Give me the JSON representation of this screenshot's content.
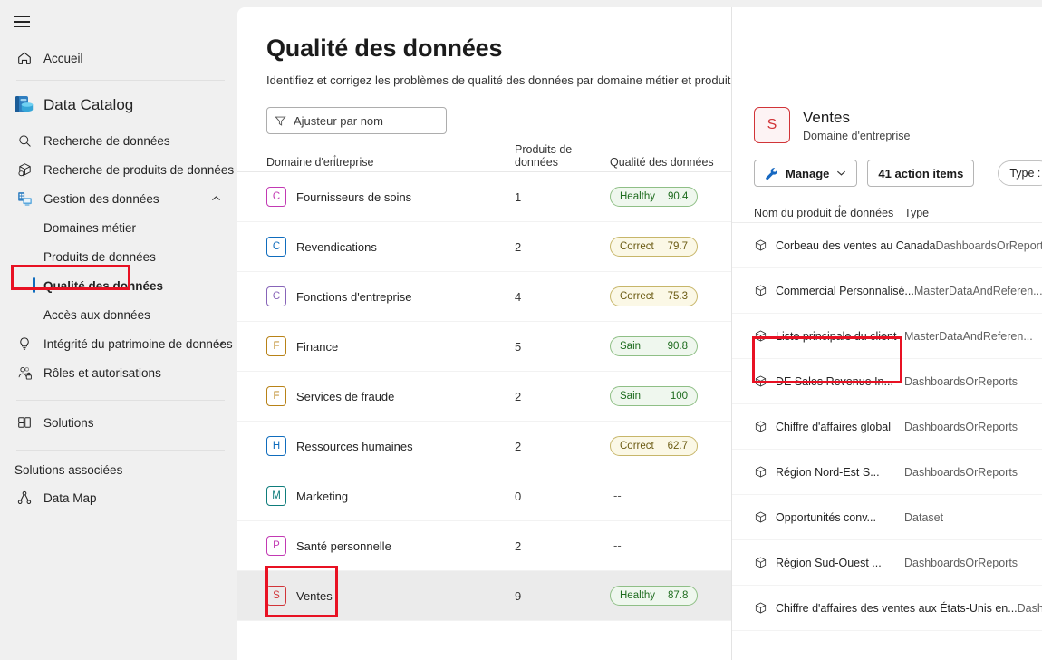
{
  "sidebar": {
    "hamburger": "menu-icon",
    "home": {
      "label": "Accueil",
      "icon": "home-icon"
    },
    "brand": {
      "label": "Data Catalog",
      "icon": "data-catalog-icon"
    },
    "items": [
      {
        "label": "Recherche de données",
        "icon": "search-icon"
      },
      {
        "label": "Recherche de produits de données",
        "icon": "package-search-icon"
      },
      {
        "label": "Gestion des données",
        "icon": "data-management-icon",
        "chevron": "⌃",
        "expanded": true
      }
    ],
    "subitems": [
      {
        "label": "Domaines métier",
        "selected": false
      },
      {
        "label": "Produits de données",
        "selected": false
      },
      {
        "label": "Qualité des données",
        "selected": true
      },
      {
        "label": "Accès aux données",
        "selected": false
      }
    ],
    "items2": [
      {
        "label": "Intégrité du patrimoine de données",
        "icon": "lightbulb-icon",
        "chevron": "⌄"
      },
      {
        "label": "Rôles et autorisations",
        "icon": "roles-icon",
        "chevron": ""
      }
    ],
    "solutions": {
      "label": "Solutions",
      "icon": "solutions-icon"
    },
    "associated_header": "Solutions associées",
    "datamap": {
      "label": "Data Map",
      "icon": "data-map-icon"
    }
  },
  "main": {
    "title": "Qualité des données",
    "subtitle": "Identifiez et corrigez les problèmes de qualité des données par domaine métier et produit de données.",
    "filter": {
      "placeholder": "Ajusteur par nom",
      "value": "",
      "icon": "filter-icon"
    },
    "columns": {
      "domain": "Domaine d'entreprise",
      "products": "Produits de données",
      "quality": "Qualité des données"
    },
    "sort_indicator": "↑",
    "rows": [
      {
        "initial": "C",
        "color": "#c239b3",
        "name": "Fournisseurs de soins",
        "products": "1",
        "quality": {
          "label": "Healthy",
          "value": "90.4",
          "state": "healthy"
        }
      },
      {
        "initial": "C",
        "color": "#0f6cbd",
        "name": "Revendications",
        "products": "2",
        "quality": {
          "label": "Correct",
          "value": "79.7",
          "state": "fair"
        }
      },
      {
        "initial": "C",
        "color": "#8764b8",
        "name": "Fonctions d'entreprise",
        "products": "4",
        "quality": {
          "label": "Correct",
          "value": "75.3",
          "state": "fair"
        }
      },
      {
        "initial": "F",
        "color": "#b88217",
        "name": "Finance",
        "products": "5",
        "quality": {
          "label": "Sain",
          "value": "90.8",
          "state": "healthy"
        }
      },
      {
        "initial": "F",
        "color": "#b88217",
        "name": "Services de fraude",
        "products": "2",
        "quality": {
          "label": "Sain",
          "value": "100",
          "state": "healthy"
        }
      },
      {
        "initial": "H",
        "color": "#0f6cbd",
        "name": "Ressources humaines",
        "products": "2",
        "quality": {
          "label": "Correct",
          "value": "62.7",
          "state": "fair"
        }
      },
      {
        "initial": "M",
        "color": "#0e7c7b",
        "name": "Marketing",
        "products": "0",
        "quality": {
          "label": "--",
          "value": "",
          "state": "none"
        }
      },
      {
        "initial": "P",
        "color": "#c239b3",
        "name": "Santé personnelle",
        "products": "2",
        "quality": {
          "label": "--",
          "value": "",
          "state": "none"
        }
      },
      {
        "initial": "S",
        "color": "#d13438",
        "name": "Ventes",
        "products": "9",
        "selected": true,
        "quality": {
          "label": "Healthy",
          "value": "87.8",
          "state": "healthy"
        }
      }
    ]
  },
  "detail": {
    "avatar_initial": "S",
    "avatar_color": "#d13438",
    "name": "Ventes",
    "kind": "Domaine d'entreprise",
    "toolbar": {
      "manage_label": "Manage",
      "manage_icon": "wrench-icon",
      "manage_chevron": "⌄",
      "action_items_label": "41 action items",
      "type_filter_label": "Type :"
    },
    "columns": {
      "name": "Nom du produit de données",
      "type": "Type"
    },
    "sort_indicator": "↑",
    "products": [
      {
        "name": "Corbeau des ventes au Canada",
        "type": "DashboardsOrReports",
        "icon": "package-icon"
      },
      {
        "name": "Commercial Personnalisé...",
        "type": "MasterDataAndReferen...",
        "icon": "package-icon"
      },
      {
        "name": "Liste principale du client",
        "type": "MasterDataAndReferen...",
        "icon": "package-icon",
        "highlighted": true
      },
      {
        "name": "DE Sales Revenue In...",
        "type": "DashboardsOrReports",
        "icon": "package-icon"
      },
      {
        "name": "Chiffre d'affaires global",
        "type": "DashboardsOrReports",
        "icon": "package-icon"
      },
      {
        "name": "Région Nord-Est S...",
        "type": "DashboardsOrReports",
        "icon": "package-icon"
      },
      {
        "name": "Opportunités conv...",
        "type": "Dataset",
        "icon": "package-icon"
      },
      {
        "name": "Région Sud-Ouest ...",
        "type": "DashboardsOrReports",
        "icon": "package-icon"
      },
      {
        "name": "Chiffre d'affaires des ventes aux États-Unis en...",
        "type": "DashboardsOrReports",
        "icon": "package-icon"
      }
    ]
  },
  "annotations": {
    "highlight_color": "#e81123",
    "boxes": [
      "qualite-des-donnees-nav",
      "ventes-row",
      "liste-principale-du-client-row"
    ]
  }
}
